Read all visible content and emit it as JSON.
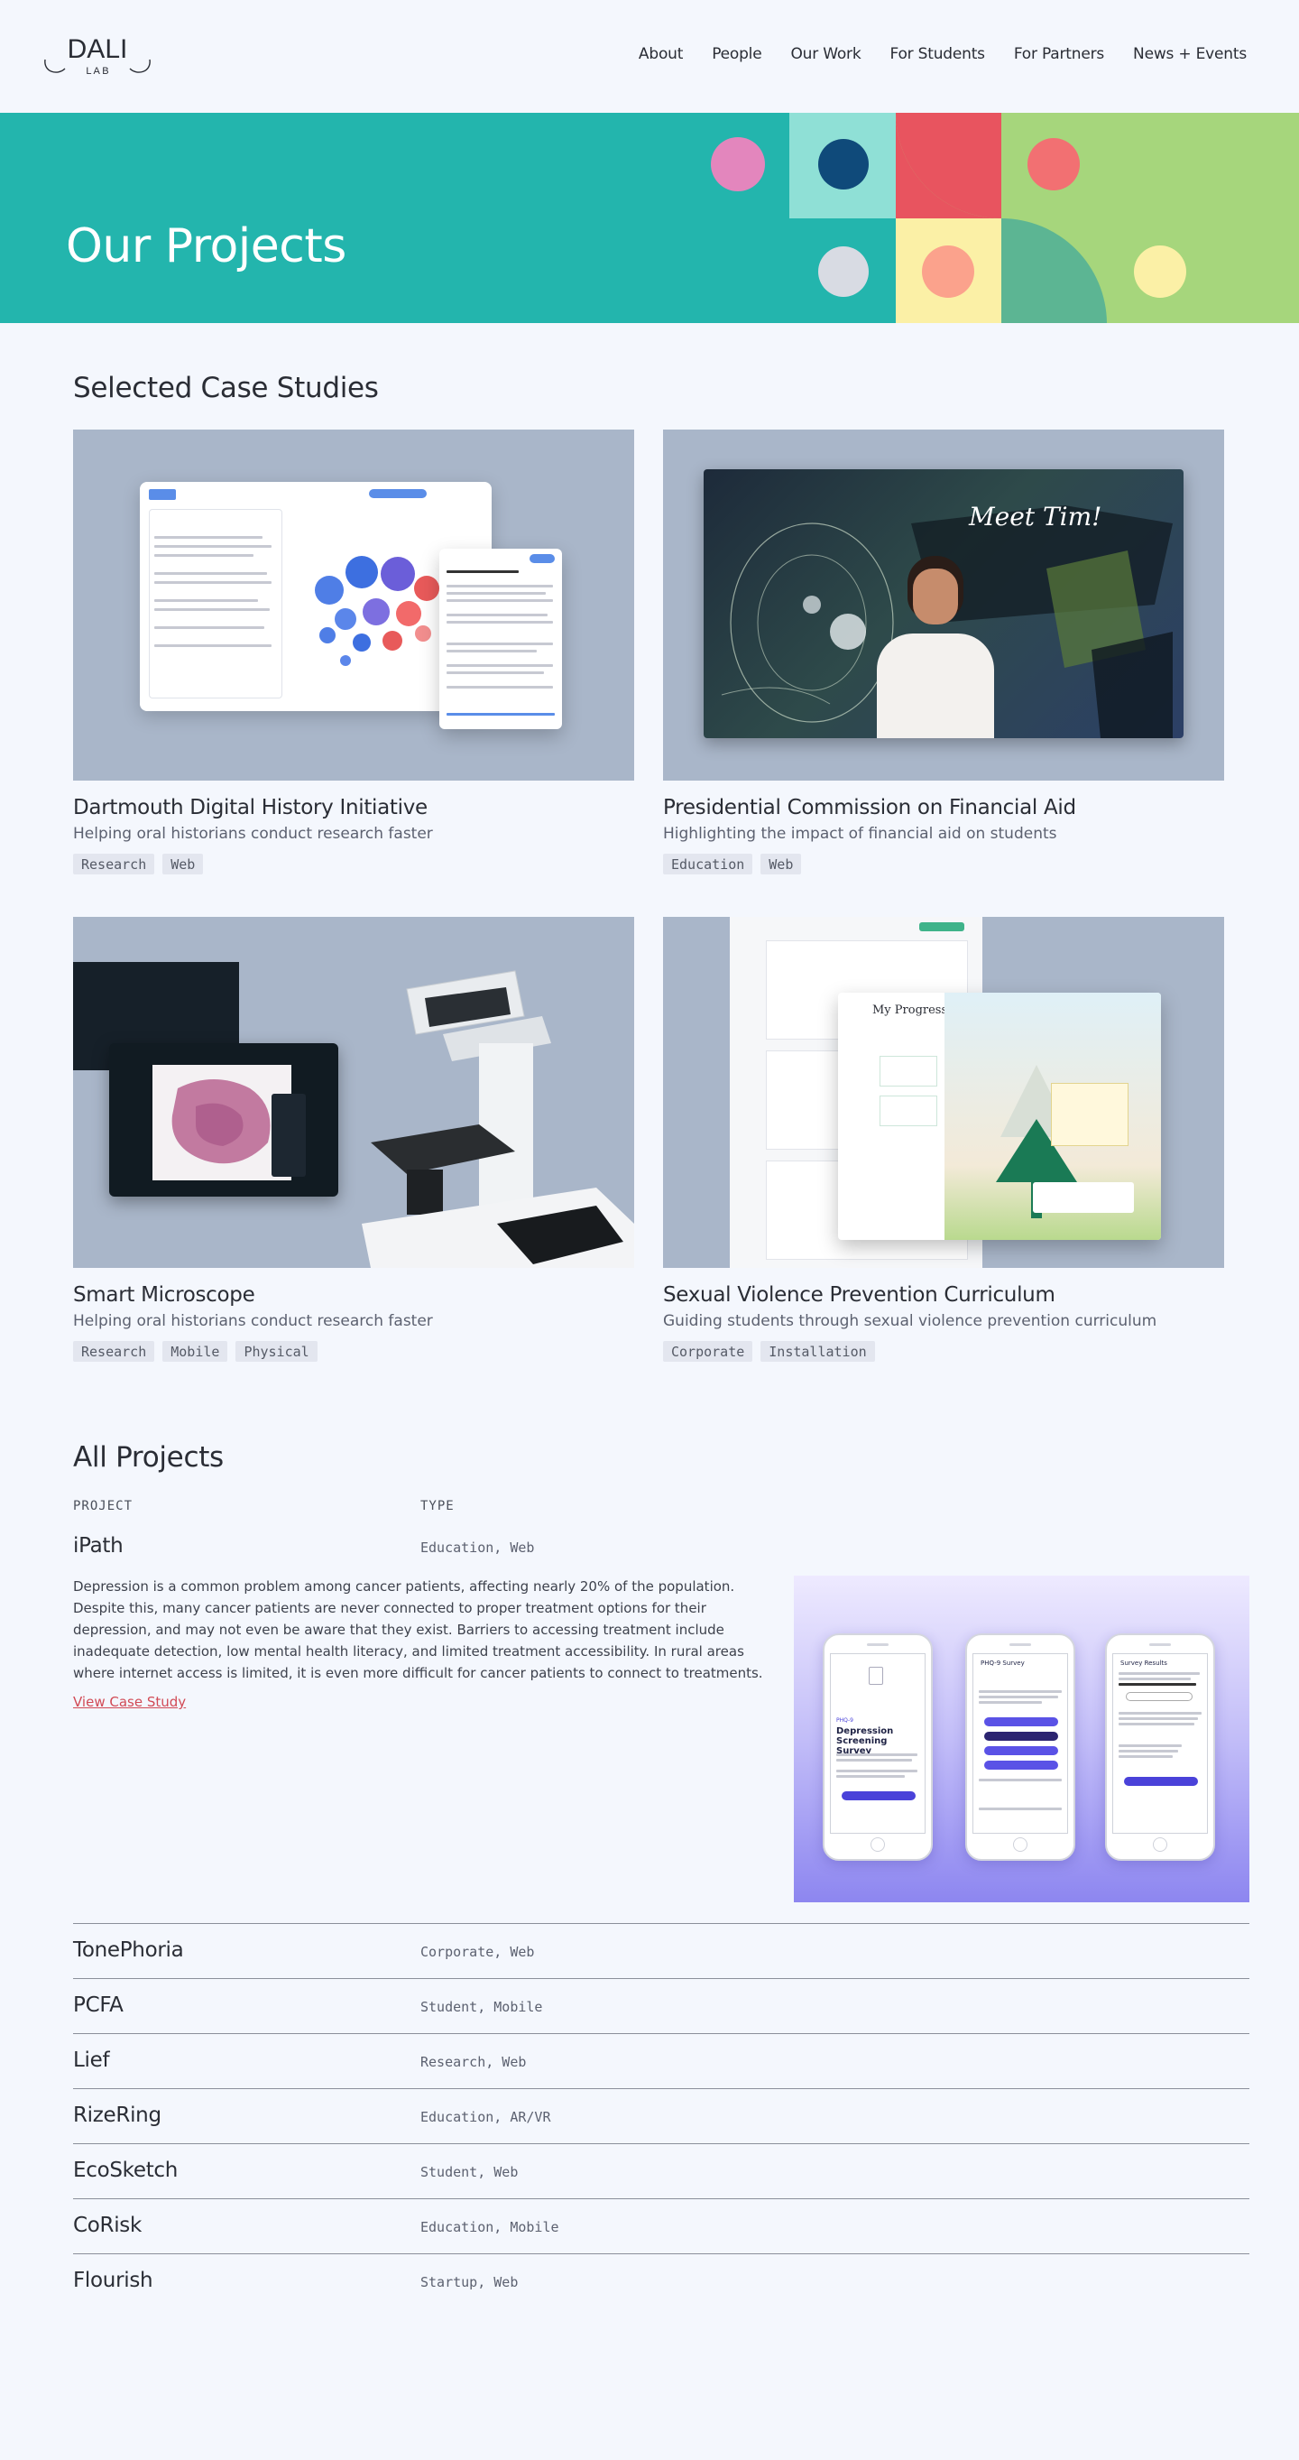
{
  "brand": {
    "logo_text": "DALI",
    "logo_sub": "L A B"
  },
  "nav": [
    {
      "label": "About"
    },
    {
      "label": "People"
    },
    {
      "label": "Our Work"
    },
    {
      "label": "For Students"
    },
    {
      "label": "For Partners"
    },
    {
      "label": "News + Events"
    }
  ],
  "hero": {
    "title": "Our Projects",
    "bg_color": "#23b5ad"
  },
  "case_studies": {
    "title": "Selected Case Studies",
    "items": [
      {
        "title": "Dartmouth Digital History Initiative",
        "subtitle": "Helping oral historians conduct research faster",
        "tags": [
          "Research",
          "Web"
        ]
      },
      {
        "title": "Presidential Commission on Financial Aid",
        "subtitle": "Highlighting the impact of financial aid on students",
        "tags": [
          "Education",
          "Web"
        ],
        "image_caption": "Meet Tim!"
      },
      {
        "title": "Smart Microscope",
        "subtitle": "Helping oral historians conduct research faster",
        "tags": [
          "Research",
          "Mobile",
          "Physical"
        ]
      },
      {
        "title": "Sexual Violence Prevention Curriculum",
        "subtitle": "Guiding students through sexual violence prevention curriculum",
        "tags": [
          "Corporate",
          "Installation"
        ],
        "image_heading": "My Progress"
      }
    ]
  },
  "all_projects": {
    "title": "All Projects",
    "col_project": "PROJECT",
    "col_type": "TYPE",
    "featured": {
      "name": "iPath",
      "type": "Education, Web",
      "description": "Depression is a common problem among cancer patients, affecting nearly 20% of the population. Despite this, many cancer patients are never connected to proper treatment options for their depression, and may not even be aware that they exist. Barriers to accessing treatment include inadequate detection, low mental health literacy, and limited treatment accessibility. In rural areas where internet access is limited, it is even more difficult for cancer patients to connect to treatments.",
      "link": "View Case Study",
      "phone_title": "Depression Screening Survey",
      "phone_small": "PHQ-9",
      "phone_2_title": "PHQ-9 Survey",
      "phone_3_title": "Survey Results"
    },
    "rows": [
      {
        "name": "TonePhoria",
        "type": "Corporate, Web"
      },
      {
        "name": "PCFA",
        "type": "Student, Mobile"
      },
      {
        "name": "Lief",
        "type": "Research, Web"
      },
      {
        "name": "RizeRing",
        "type": "Education, AR/VR"
      },
      {
        "name": "EcoSketch",
        "type": "Student, Web"
      },
      {
        "name": "CoRisk",
        "type": "Education, Mobile"
      },
      {
        "name": "Flourish",
        "type": "Startup, Web"
      }
    ]
  },
  "colors": {
    "accent_link": "#d14a55",
    "background": "#f4f7fd",
    "card_bg": "#a9b6c9"
  }
}
